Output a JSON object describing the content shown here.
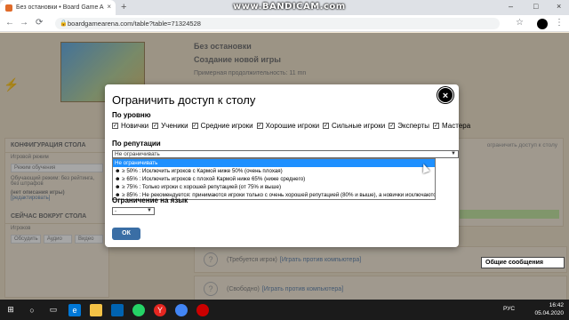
{
  "browser": {
    "tab_title": "Без остановки • Board Game A",
    "tab_close": "×",
    "new_tab": "+",
    "watermark": "www.BANDICAM.com",
    "url": "boardgamearena.com/table?table=71324528",
    "controls": {
      "minimize": "–",
      "maximize": "□",
      "close": "×"
    },
    "nav": {
      "back": "←",
      "forward": "→",
      "reload": "⟳"
    },
    "star": "☆",
    "menu": "⋮"
  },
  "game": {
    "title": "Без остановки",
    "subtitle": "Создание новой игры",
    "duration": "Примерная продолжительность: 11 mn"
  },
  "left_panel": {
    "header": "КОНФИГУРАЦИЯ СТОЛА",
    "mode_label": "Игровой режим",
    "mode_value": "Режим обучения",
    "mode_desc": "Обучающий режим: без рейтинга, без штрафов",
    "description_missing": "(нет описания игры)",
    "edit_link": "[редактировать]",
    "social_header": "СЕЙЧАС ВОКРУГ СТОЛА",
    "social_sub": "Игроков",
    "buttons": [
      "Обсудить",
      "Аудио",
      "Видео"
    ]
  },
  "right_panel": {
    "header": "ограничить доступ к столу"
  },
  "slots": [
    {
      "label": "(Требуется игрок)",
      "link": "[Играть против компьютера]"
    },
    {
      "label": "(Свободно)",
      "link": "[Играть против компьютера]"
    }
  ],
  "chat_box": "Общие сообщения",
  "modal": {
    "title": "Ограничить доступ к столу",
    "close": "×",
    "level_label": "По уровню",
    "check_mark": "✓",
    "levels": [
      "Новички",
      "Ученики",
      "Средние игроки",
      "Хорошие игроки",
      "Сильные игроки",
      "Эксперты",
      "Мастера"
    ],
    "reputation_label": "По репутации",
    "reputation_selected": "Не ограничивать",
    "reputation_options": [
      "Не ограничивать",
      "☻ ≥ 50% : Исключить игроков с Кармой ниже 50% (очень плохая)",
      "☻ ≥ 65% : Исключить игроков с плохой Кармой ниже 65% (ниже среднего)",
      "☻ ≥ 75% : Только игроки с хорошей репутацией (от 75% и выше)",
      "☻ ≥ 85% : Не рекомендуется: принимаются игроки только с очень хорошей репутацией (80% и выше), а новички исключаются"
    ],
    "language_label": "Ограничение на язык",
    "language_value": "-",
    "dropdown_arrow": "▼",
    "ok_label": "ОК"
  },
  "taskbar": {
    "lang": "РУС",
    "time": "16:42",
    "date": "05.04.2020"
  }
}
